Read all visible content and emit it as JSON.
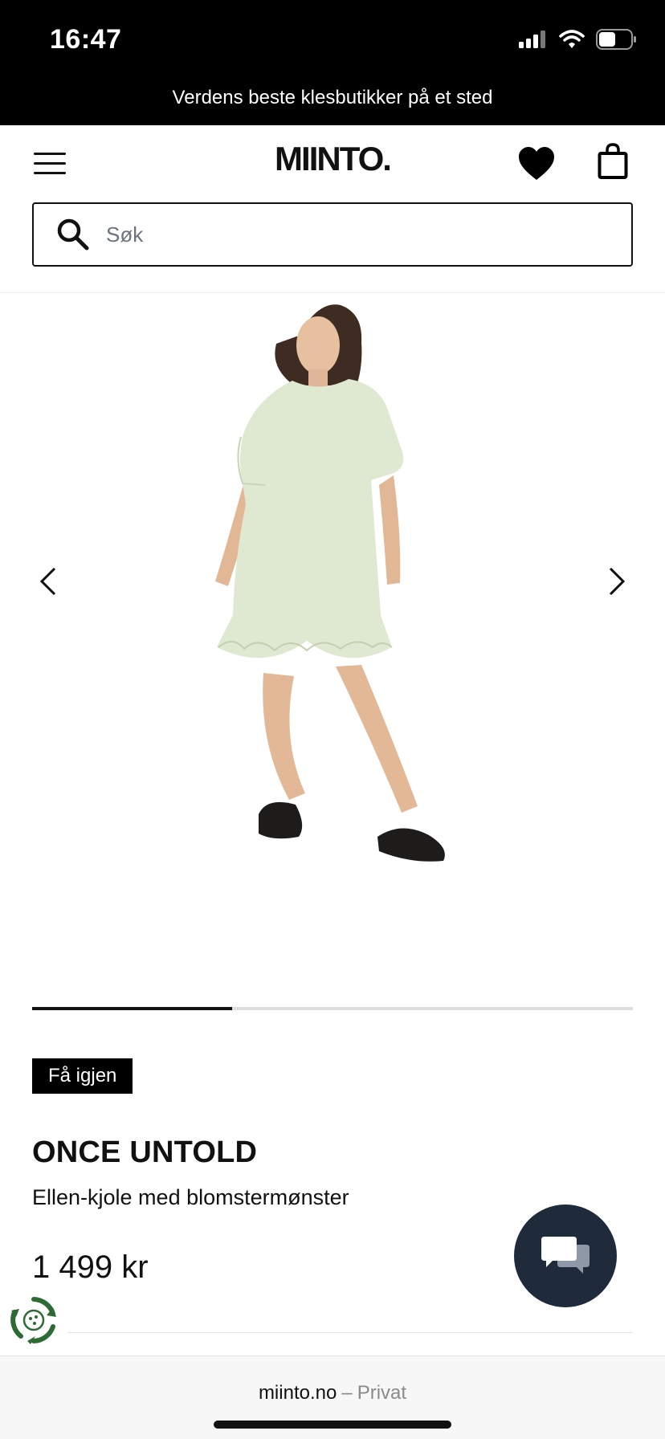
{
  "status_bar": {
    "time": "16:47",
    "icons": [
      "cellular-signal-icon",
      "wifi-icon",
      "battery-icon"
    ]
  },
  "promo": {
    "text": "Verdens beste klesbutikker på et sted"
  },
  "header": {
    "logo": "MIINTO.",
    "icons": [
      "hamburger-menu-icon",
      "heart-icon",
      "shopping-bag-icon"
    ]
  },
  "search": {
    "placeholder": "Søk",
    "value": ""
  },
  "gallery": {
    "image_count": 3,
    "current_index": 1,
    "progress_fraction": 0.333,
    "icons": [
      "chevron-left-icon",
      "chevron-right-icon"
    ]
  },
  "product": {
    "badge": "Få igjen",
    "brand": "ONCE UNTOLD",
    "name": "Ellen-kjole med blomstermønster",
    "price": "1 499 kr"
  },
  "chat": {
    "icon": "chat-bubbles-icon"
  },
  "eco": {
    "icon": "recycle-badge-icon"
  },
  "browser_bar": {
    "domain": "miinto.no",
    "separator": "–",
    "mode": "Privat"
  },
  "colors": {
    "black": "#000000",
    "chat_bg": "#1f2a3b",
    "eco_green": "#2e6a34",
    "dress": "#dfe8d1"
  }
}
